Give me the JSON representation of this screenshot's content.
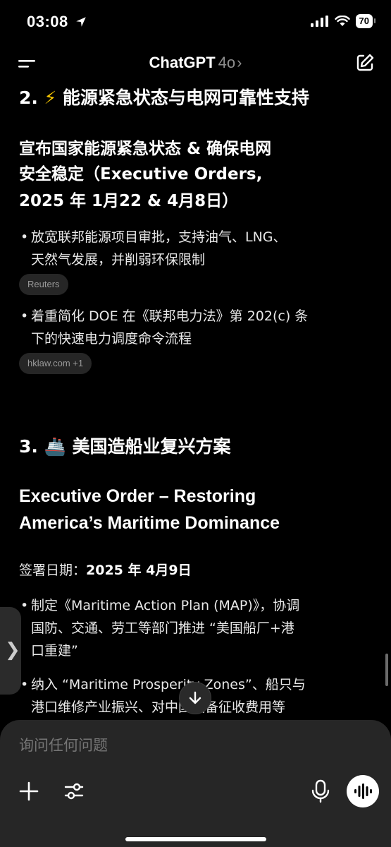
{
  "status_bar": {
    "time": "03:08",
    "battery": "70"
  },
  "nav": {
    "title": "ChatGPT",
    "model": "4o",
    "chevron": "›"
  },
  "content": {
    "section2": {
      "heading_num": "2.",
      "heading_icon": "⚡",
      "heading_text": "能源紧急状态与电网可靠性支持",
      "subheading_lines": [
        "宣布国家能源紧急状态 & 确保电网",
        "安全稳定（Executive Orders,",
        "2025 年 1月22 & 4月8日）"
      ],
      "bullets": [
        {
          "lines": [
            "放宽联邦能源项目审批，支持油气、LNG、",
            "天然气发展，并削弱环保限制"
          ],
          "chip": "Reuters"
        },
        {
          "lines": [
            "着重简化 DOE 在《联邦电力法》第 202(c) 条",
            "下的快速电力调度命令流程"
          ],
          "chip": "hklaw.com +1"
        }
      ]
    },
    "section3": {
      "heading_num": "3.",
      "heading_icon": "🚢",
      "heading_text": "美国造船业复兴方案",
      "subheading_lines": [
        "Executive Order – Restoring",
        "America’s Maritime Dominance"
      ],
      "date_label": "签署日期：",
      "date_value": "2025 年 4月9日",
      "bullets": [
        {
          "lines": [
            "制定《Maritime Action Plan (MAP)》，协调",
            "国防、交通、劳工等部门推进 “美国船厂+港",
            "口重建”"
          ]
        },
        {
          "lines": [
            "纳入 “Maritime Prosperity Zones”、船只与",
            "港口维修产业振兴、对中国设备征收费用等"
          ]
        }
      ]
    }
  },
  "composer": {
    "placeholder": "询问任何问题"
  },
  "icons": {
    "location": "location-arrow-icon",
    "signal": "cellular-signal-icon",
    "wifi": "wifi-icon",
    "menu": "menu-icon",
    "new_chat": "new-chat-icon",
    "scroll_down": "arrow-down-icon",
    "plus": "plus-icon",
    "tools": "sliders-icon",
    "mic": "microphone-icon",
    "voice": "voice-waveform-icon"
  }
}
